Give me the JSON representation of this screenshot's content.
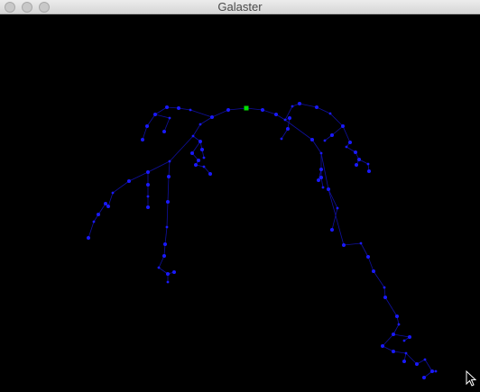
{
  "window": {
    "title": "Galaster",
    "background_color": "#000000"
  },
  "titlebar_buttons": [
    {
      "name": "close-button",
      "icon": "close-icon"
    },
    {
      "name": "minimize-button",
      "icon": "minimize-icon"
    },
    {
      "name": "zoom-button",
      "icon": "zoom-icon"
    }
  ],
  "graph": {
    "node_color": "#1a1aff",
    "edge_color": "#1010a0",
    "selected_node_color": "#00e000"
  }
}
